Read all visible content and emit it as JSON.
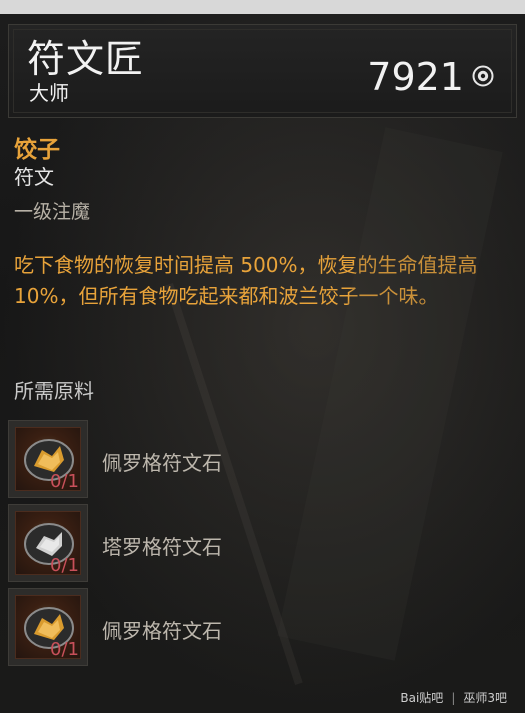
{
  "header": {
    "title": "符文匠",
    "subtitle": "大师",
    "gold_amount": "7921",
    "gold_icon": "coin-icon"
  },
  "item": {
    "name": "饺子",
    "type": "符文",
    "enchant_level": "一级注魔",
    "description": "吃下食物的恢复时间提高 500%，恢复的生命值提高 10%，但所有食物吃起来都和波兰饺子一个味。"
  },
  "materials": {
    "title": "所需原料",
    "items": [
      {
        "name": "佩罗格符文石",
        "qty": "0/1",
        "icon": "gold-rune-stone-icon"
      },
      {
        "name": "塔罗格符文石",
        "qty": "0/1",
        "icon": "silver-rune-stone-icon"
      },
      {
        "name": "佩罗格符文石",
        "qty": "0/1",
        "icon": "gold-rune-stone-icon"
      }
    ]
  },
  "watermark": {
    "left": "Bai贴吧",
    "right": "巫师3吧"
  },
  "colors": {
    "gold_text": "#e8a33a",
    "missing_qty": "#c8505a",
    "panel_bg": "#1a1a1a"
  }
}
